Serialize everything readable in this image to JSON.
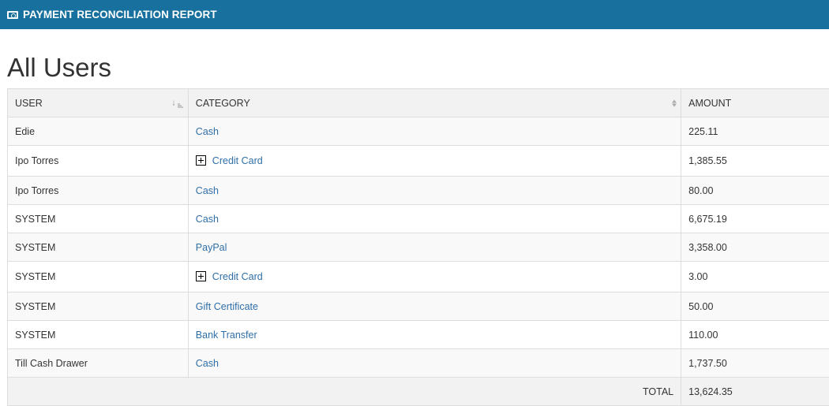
{
  "header": {
    "icon": "money-bill-icon",
    "title": "PAYMENT RECONCILIATION REPORT",
    "background_color": "#17709d"
  },
  "page_title": "All Users",
  "table": {
    "columns": [
      {
        "label": "USER",
        "sort": "ascending"
      },
      {
        "label": "CATEGORY",
        "sort": "unsorted"
      },
      {
        "label": "AMOUNT",
        "sort": "none"
      }
    ],
    "rows": [
      {
        "user": "Edie",
        "category": "Cash",
        "expandable": false,
        "amount": "225.11"
      },
      {
        "user": "Ipo Torres",
        "category": "Credit Card",
        "expandable": true,
        "amount": "1,385.55"
      },
      {
        "user": "Ipo Torres",
        "category": "Cash",
        "expandable": false,
        "amount": "80.00"
      },
      {
        "user": "SYSTEM",
        "category": "Cash",
        "expandable": false,
        "amount": "6,675.19"
      },
      {
        "user": "SYSTEM",
        "category": "PayPal",
        "expandable": false,
        "amount": "3,358.00"
      },
      {
        "user": "SYSTEM",
        "category": "Credit Card",
        "expandable": true,
        "amount": "3.00"
      },
      {
        "user": "SYSTEM",
        "category": "Gift Certificate",
        "expandable": false,
        "amount": "50.00"
      },
      {
        "user": "SYSTEM",
        "category": "Bank Transfer",
        "expandable": false,
        "amount": "110.00"
      },
      {
        "user": "Till Cash Drawer",
        "category": "Cash",
        "expandable": false,
        "amount": "1,737.50"
      }
    ],
    "total": {
      "label": "TOTAL",
      "amount": "13,624.35"
    },
    "link_color": "#2f6fa8"
  }
}
